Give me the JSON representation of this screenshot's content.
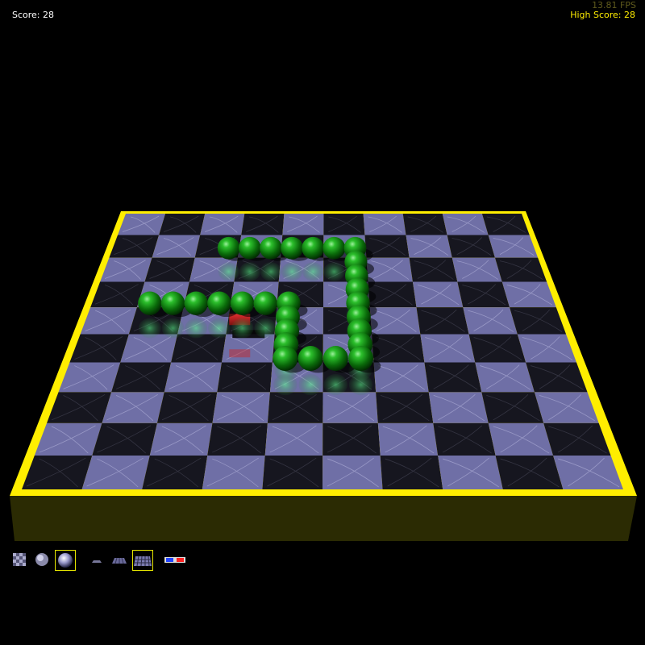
{
  "hud": {
    "score": "Score: 28",
    "fps": "13.81 FPS",
    "high_score": "High Score: 28"
  },
  "colors": {
    "border": "#ffee00",
    "board_side": "#2a2a00",
    "tile_light": "#6f6fa6",
    "tile_dark": "#16161f",
    "snake": "#1fa31f",
    "food": "#cc2222"
  },
  "board": {
    "columns": 10,
    "rows": 10
  },
  "snake": {
    "length": 28,
    "segments": [
      [
        5,
        2
      ],
      [
        6,
        2
      ],
      [
        7,
        2
      ],
      [
        8,
        2
      ],
      [
        9,
        2
      ],
      [
        10,
        2
      ],
      [
        11,
        2
      ],
      [
        11,
        3
      ],
      [
        11,
        4
      ],
      [
        11,
        5
      ],
      [
        11,
        6
      ],
      [
        11,
        7
      ],
      [
        11,
        8
      ],
      [
        11,
        9
      ],
      [
        11,
        10
      ],
      [
        10,
        10
      ],
      [
        9,
        10
      ],
      [
        8,
        10
      ],
      [
        8,
        9
      ],
      [
        8,
        8
      ],
      [
        8,
        7
      ],
      [
        8,
        6
      ],
      [
        7,
        6
      ],
      [
        6,
        6
      ],
      [
        5,
        6
      ],
      [
        4,
        6
      ],
      [
        3,
        6
      ],
      [
        2,
        6
      ]
    ]
  },
  "food": [
    6,
    7
  ],
  "toolbar": {
    "items": [
      {
        "icon": "quality-low-icon",
        "selected": false
      },
      {
        "icon": "quality-medium-icon",
        "selected": false
      },
      {
        "icon": "quality-high-icon",
        "selected": true
      },
      {
        "icon": "board-small-icon",
        "selected": false
      },
      {
        "icon": "board-medium-icon",
        "selected": false
      },
      {
        "icon": "board-large-icon",
        "selected": true
      },
      {
        "icon": "3d-glasses-icon",
        "selected": false
      }
    ]
  }
}
